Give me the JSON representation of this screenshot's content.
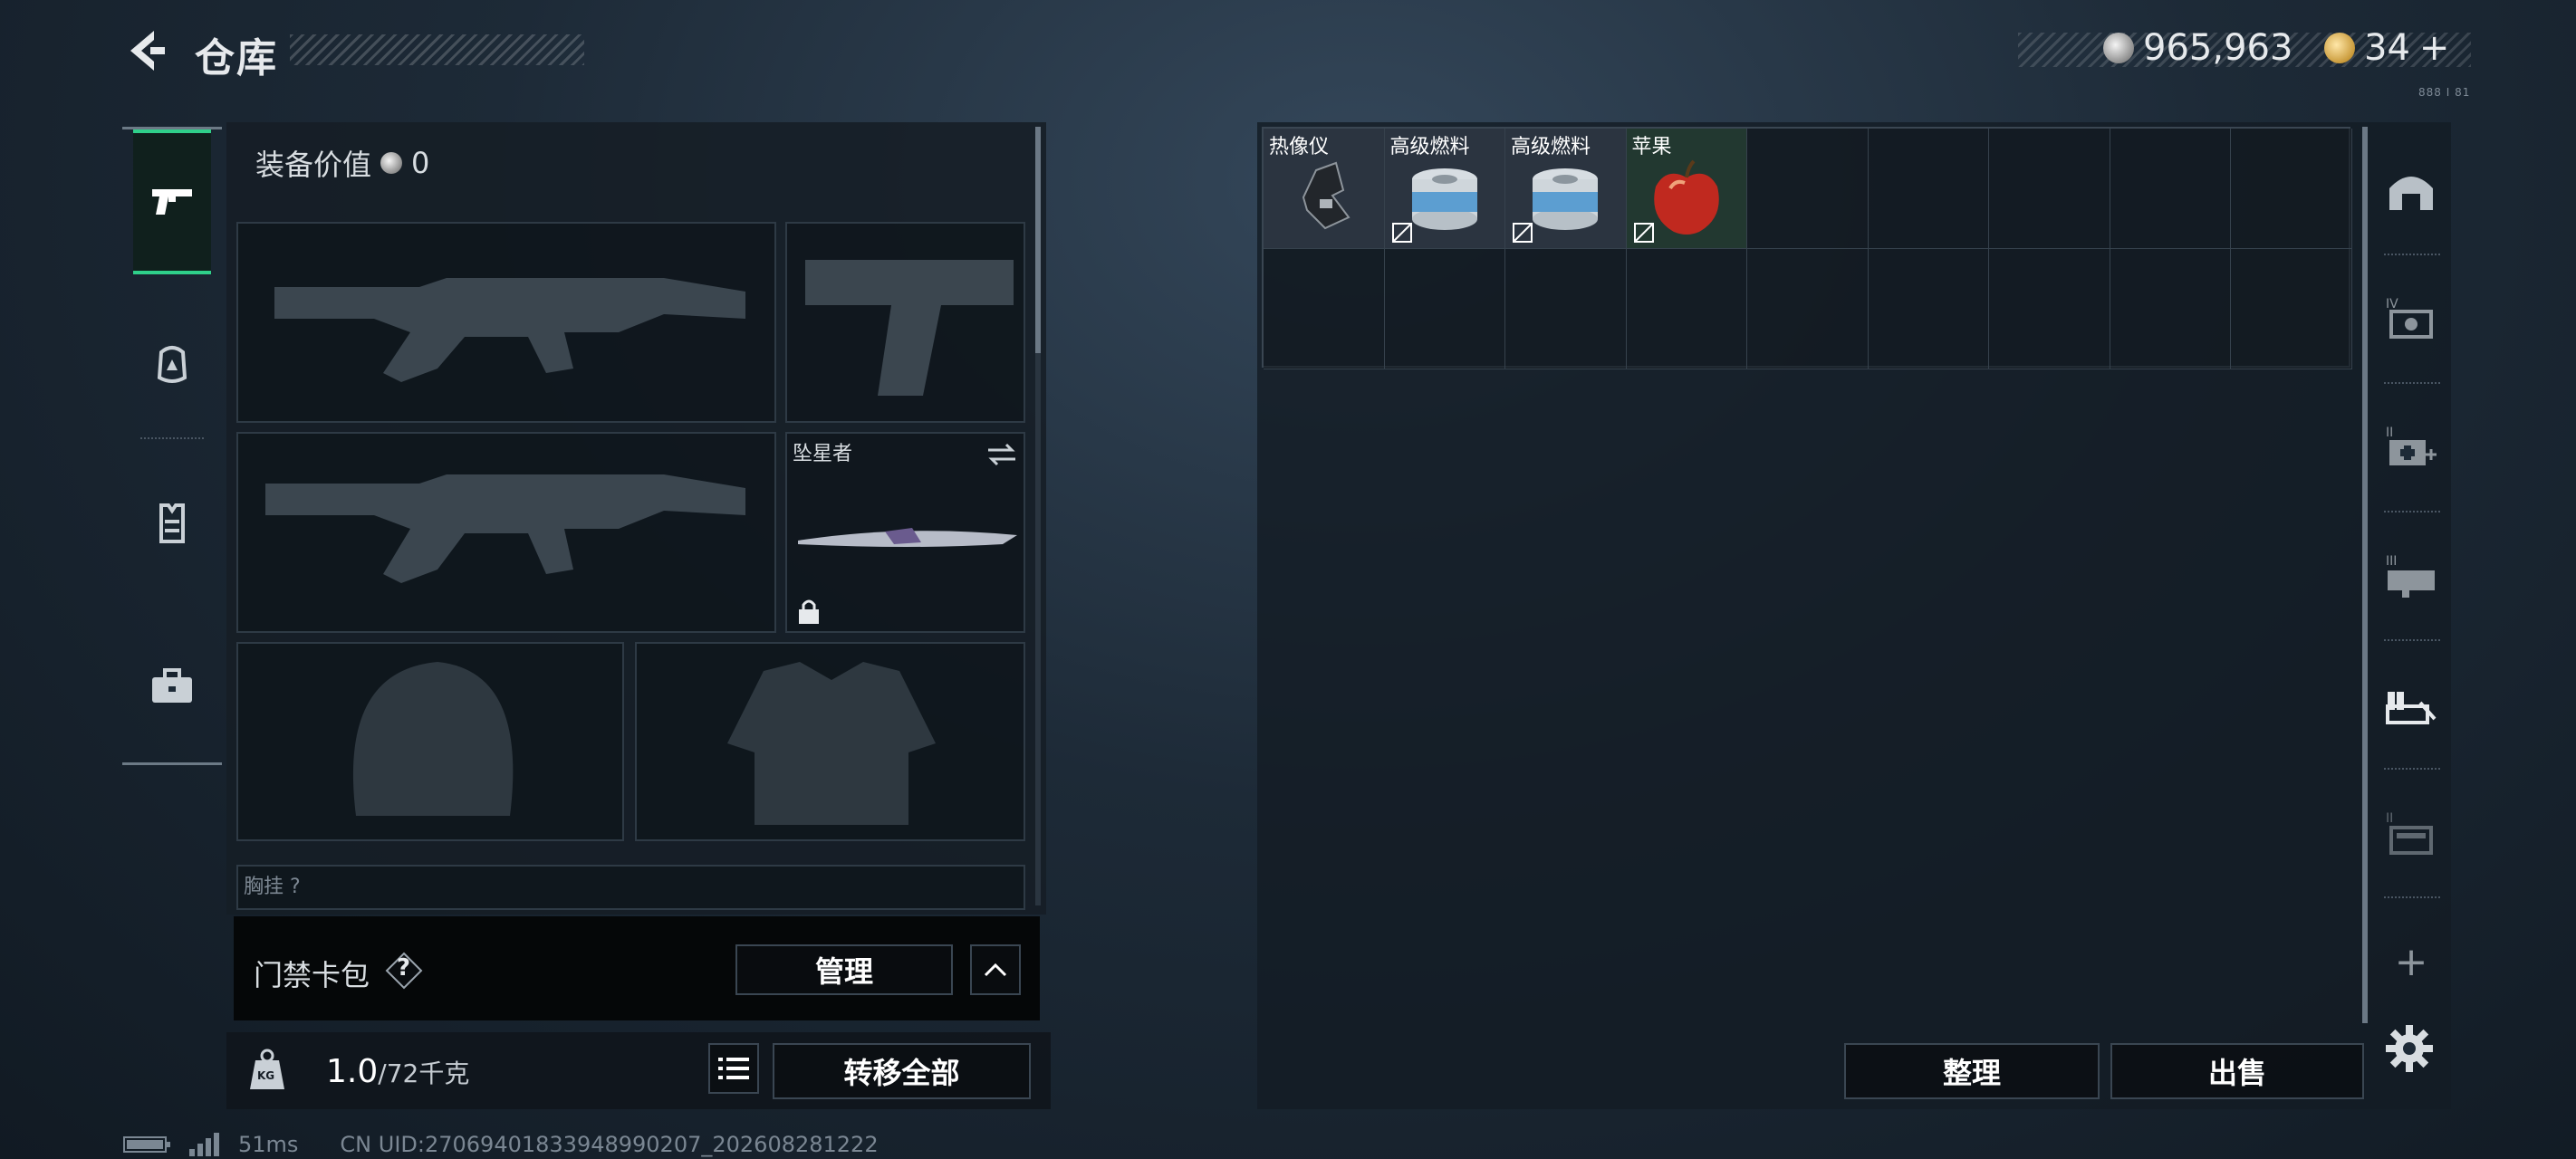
{
  "header": {
    "title": "仓库",
    "coins": "965,963",
    "tickets": "34",
    "plus": "+",
    "corner_text": "888 I 81"
  },
  "left_nav": {
    "items": [
      {
        "icon": "pistol-icon",
        "active": true
      },
      {
        "icon": "helmet-icon",
        "active": false
      },
      {
        "icon": "vest-icon",
        "active": false
      },
      {
        "icon": "briefcase-icon",
        "active": false
      }
    ]
  },
  "equipment": {
    "value_label": "装备价值",
    "value": "0",
    "melee_slot_label": "坠星者",
    "chest_label": "胸挂 ?"
  },
  "access_card": {
    "label": "门禁卡包",
    "help": "?",
    "manage_button": "管理"
  },
  "weight": {
    "current": "1.0",
    "capacity": "/72千克",
    "kg_label": "KG",
    "transfer_all_button": "转移全部"
  },
  "stash": {
    "items": [
      {
        "name": "热像仪",
        "icon": "thermal-imager-icon"
      },
      {
        "name": "高级燃料",
        "icon": "fuel-can-icon"
      },
      {
        "name": "高级燃料",
        "icon": "fuel-can-icon"
      },
      {
        "name": "苹果",
        "icon": "apple-icon"
      }
    ],
    "sort_button": "整理",
    "sell_button": "出售"
  },
  "right_nav": {
    "items": [
      {
        "icon": "helmet-view-icon"
      },
      {
        "icon": "tier-iv-stash-icon"
      },
      {
        "icon": "tier-ii-medkit-icon"
      },
      {
        "icon": "tier-iii-weapon-case-icon"
      },
      {
        "icon": "ammo-case-icon"
      },
      {
        "icon": "tier-ii-supply-icon"
      }
    ],
    "add": "+"
  },
  "status": {
    "ping": "51ms",
    "uid": "CN UID:27069401833948990207_202608281222"
  },
  "colors": {
    "accent": "#2fd08a",
    "panel": "#161e26"
  }
}
